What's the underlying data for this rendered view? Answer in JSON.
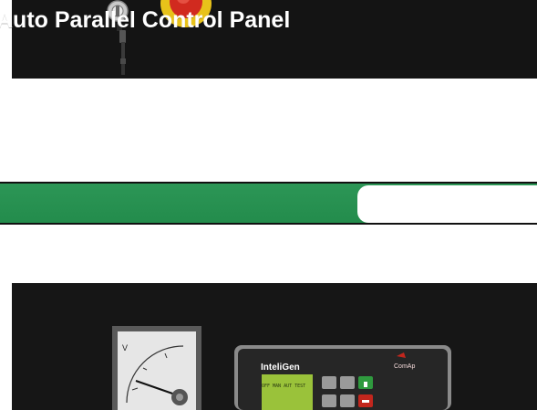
{
  "heading": {
    "title": "Auto Parallel Control Panel",
    "band_color": "#2a9454"
  },
  "top_panel": {
    "background": "#141414",
    "components": [
      "key-switch",
      "emergency-stop-button"
    ]
  },
  "bottom_panel": {
    "background": "#161616",
    "voltmeter": {
      "unit_label": "V"
    },
    "controller": {
      "brand": "InteliGen",
      "maker": "ComAp",
      "display_text": "OFF MAN AUT TEST"
    }
  }
}
